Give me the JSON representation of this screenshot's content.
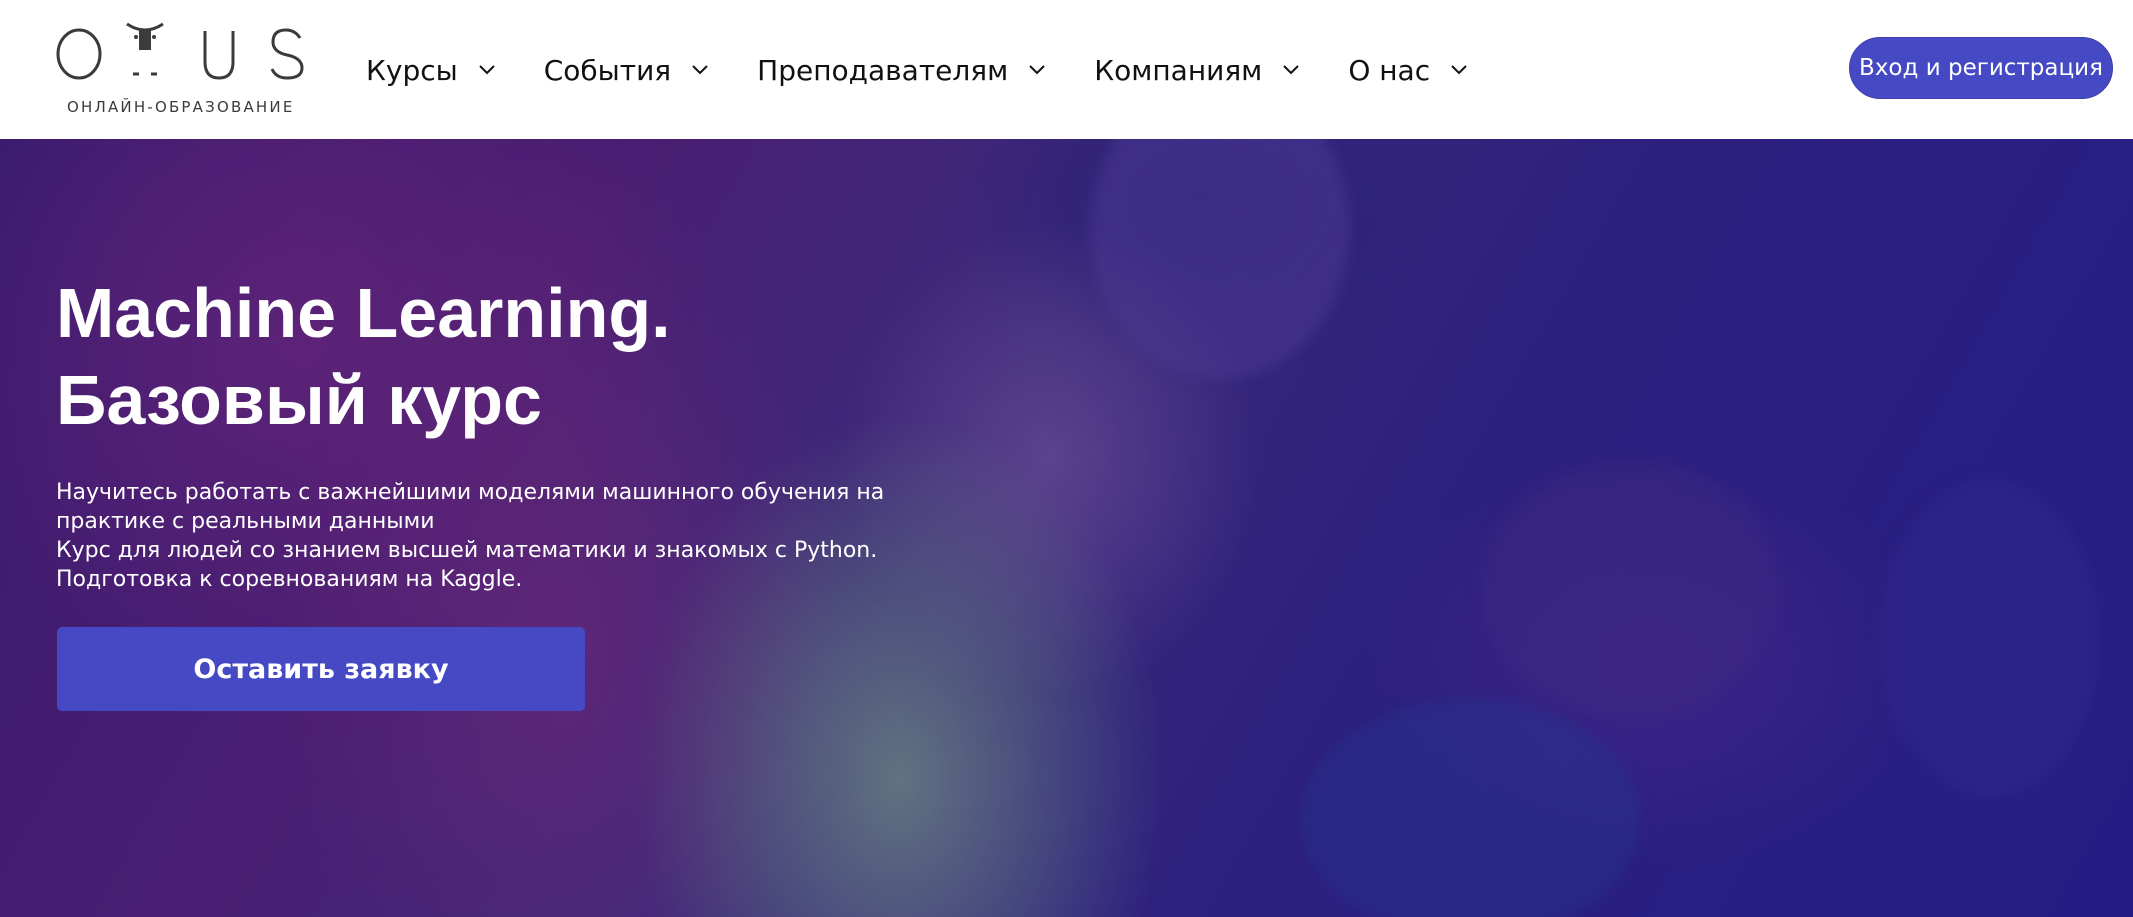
{
  "header": {
    "logo": {
      "letters": [
        "O",
        "T",
        "U",
        "S"
      ],
      "subtitle": "ОНЛАЙН-ОБРАЗОВАНИЕ"
    },
    "nav": [
      {
        "label": "Курсы",
        "icon": "chevron-down-icon"
      },
      {
        "label": "События",
        "icon": "chevron-down-icon"
      },
      {
        "label": "Преподавателям",
        "icon": "chevron-down-icon"
      },
      {
        "label": "Компаниям",
        "icon": "chevron-down-icon"
      },
      {
        "label": "О нас",
        "icon": "chevron-down-icon"
      }
    ],
    "login_label": "Вход и регистрация"
  },
  "hero": {
    "title_lines": [
      "Machine Learning.",
      "Базовый курс"
    ],
    "description_lines": [
      "Научитесь работать с важнейшими моделями машинного обучения на",
      "практике с реальными данными",
      "Курс для людей со знанием высшей математики и знакомых с Python.",
      "Подготовка к соревнованиям на Kaggle."
    ],
    "cta_label": "Оставить заявку"
  },
  "colors": {
    "accent": "#4649c4",
    "hero_dark": "#261d84",
    "hero_purple": "#4a1e72",
    "text_dark": "#111111",
    "text_light": "#ffffff"
  }
}
